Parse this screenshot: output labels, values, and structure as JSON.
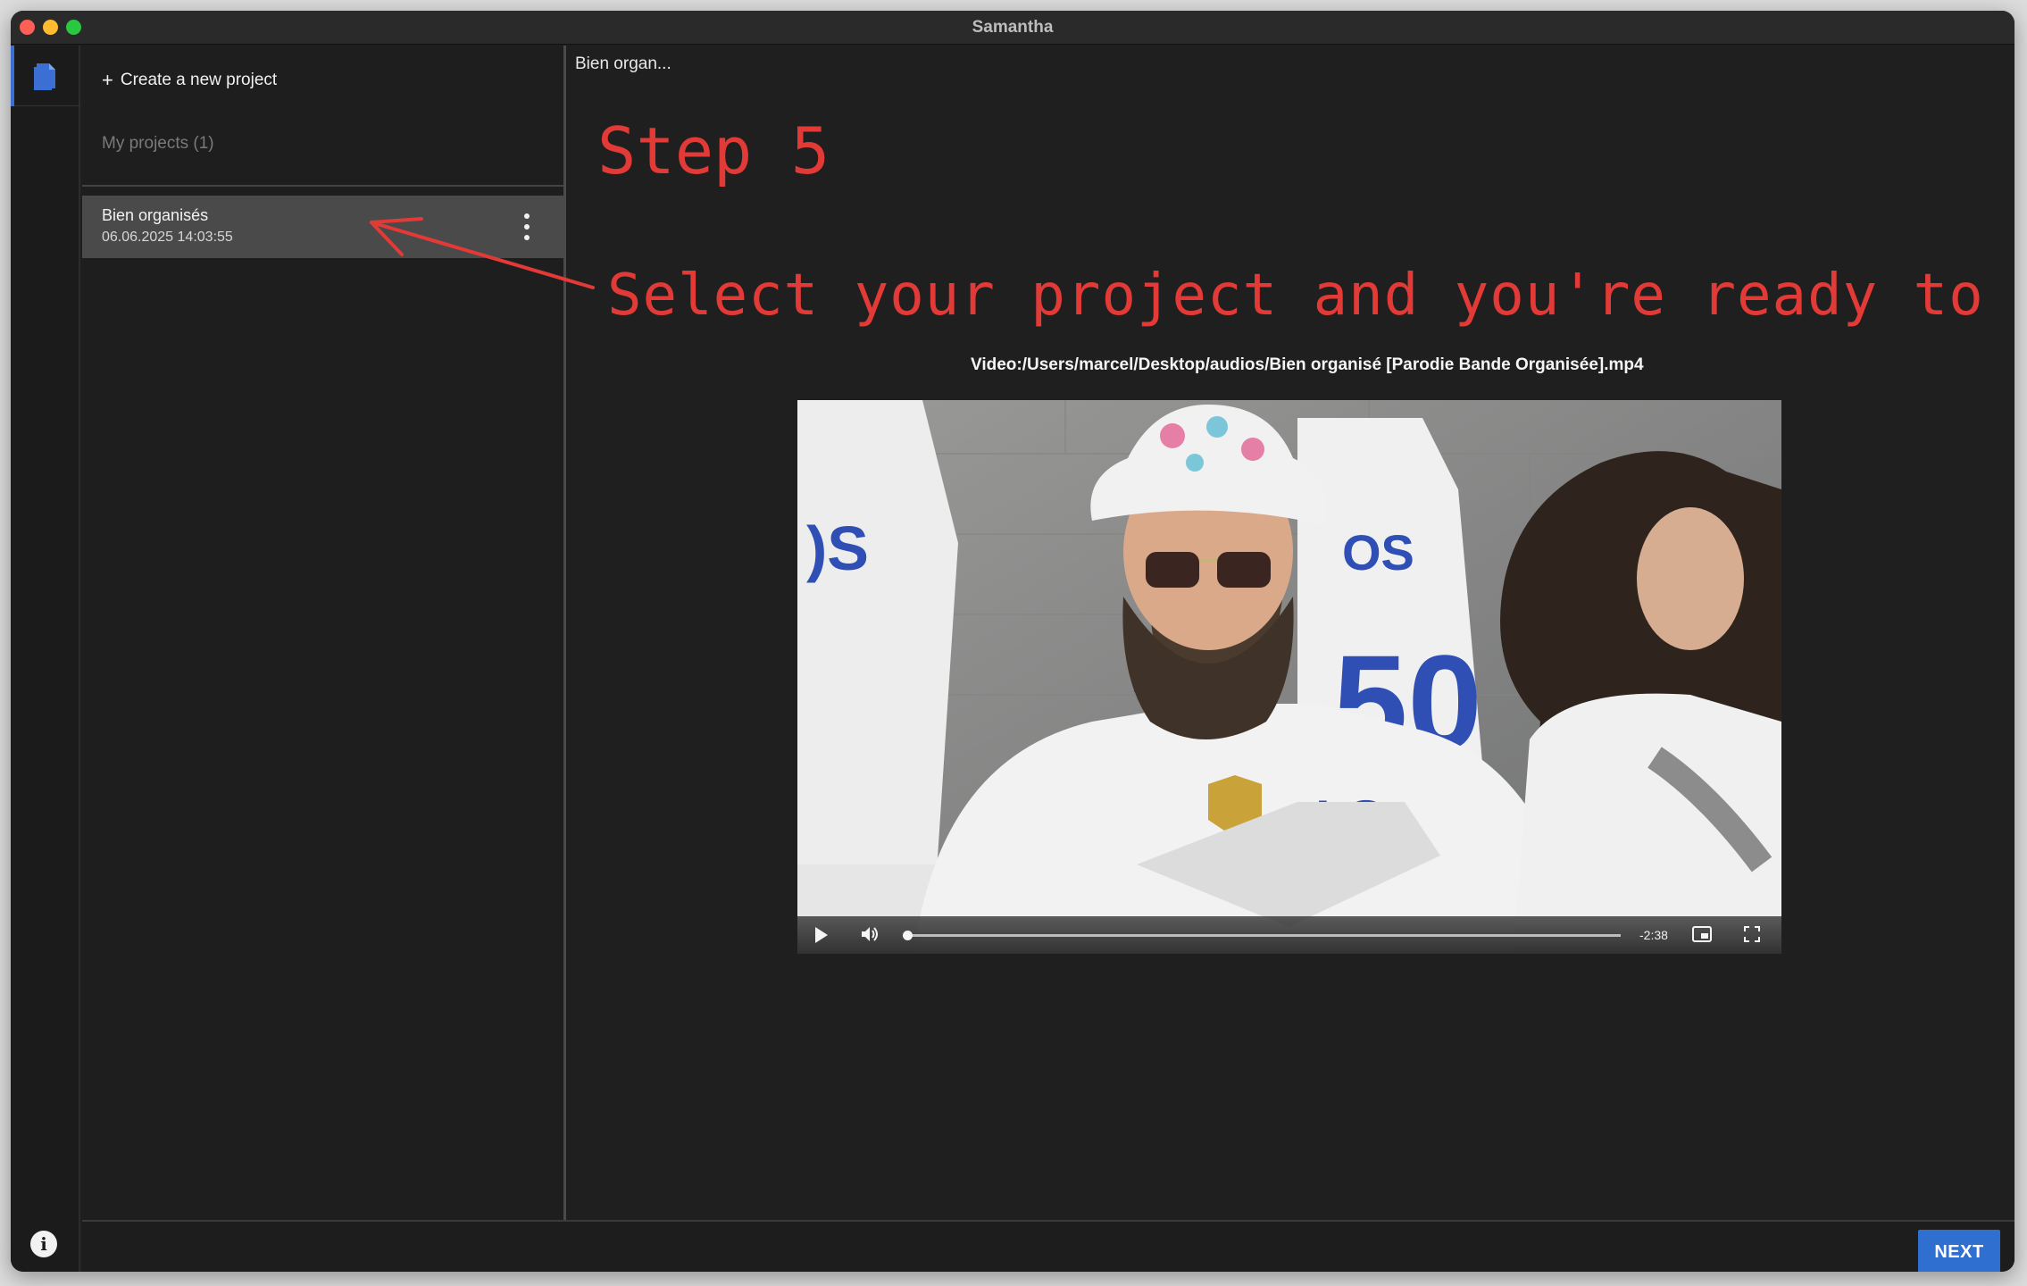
{
  "window": {
    "title": "Samantha"
  },
  "sidebar": {
    "create_label": "Create a new project",
    "create_symbol": "+",
    "projects_label": "My projects (1)",
    "projects": [
      {
        "name": "Bien organisés",
        "date": "06.06.2025 14:03:55"
      }
    ]
  },
  "main": {
    "breadcrumb": "Bien organ...",
    "video_path": "Video:/Users/marcel/Desktop/audios/Bien organisé [Parodie Bande Organisée].mp4",
    "player": {
      "time_remaining": "-2:38",
      "progress": 0.0
    }
  },
  "footer": {
    "next_label": "NEXT"
  },
  "annotations": {
    "step": "Step 5",
    "hint": "Select your project and you're ready to go !"
  },
  "colors": {
    "accent": "#2f6fd0",
    "annotation": "#e23a36",
    "selected_row": "#4a4a4a"
  },
  "icons": {
    "sidebar_top": "document-icon",
    "bottom_left": "info-icon"
  }
}
